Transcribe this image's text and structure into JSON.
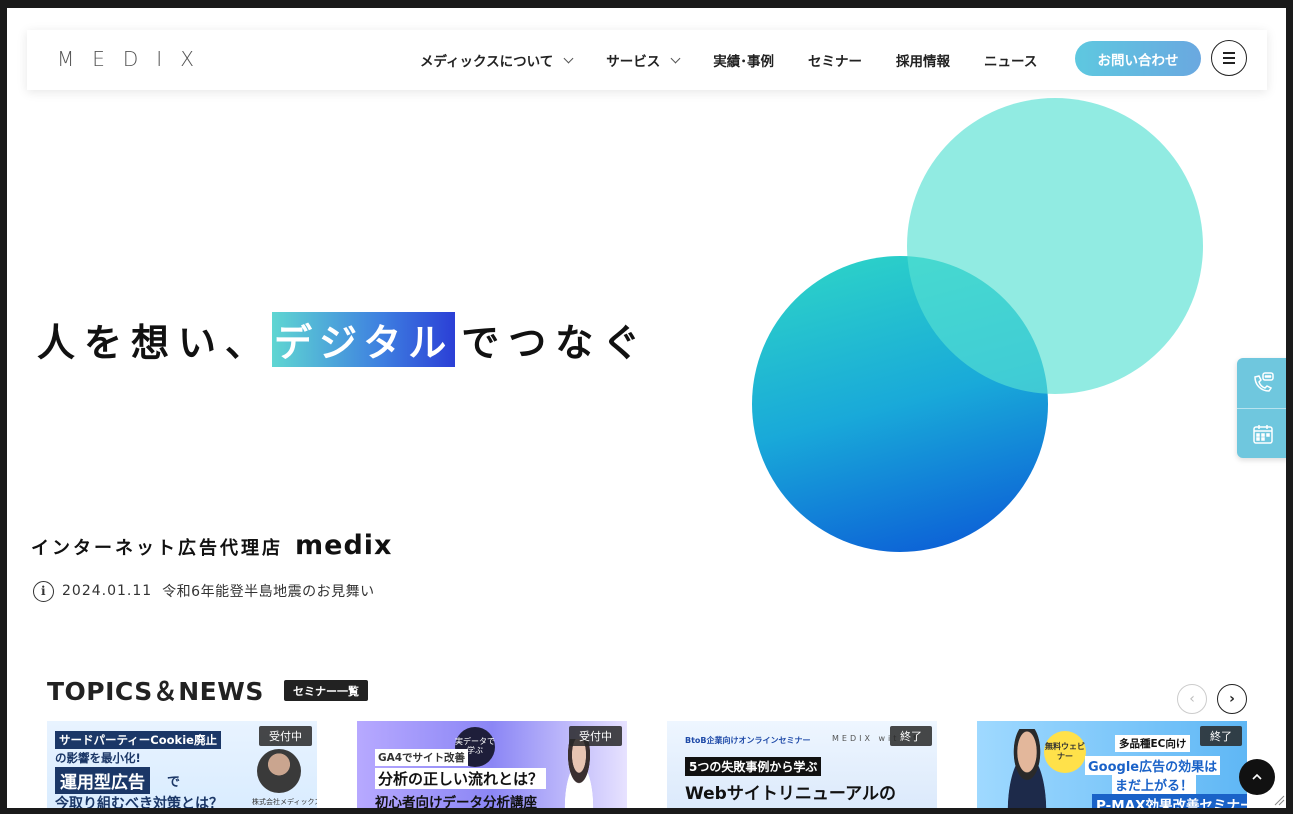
{
  "header": {
    "logo": "MEDIX",
    "nav": [
      {
        "label": "メディックスについて",
        "has_dropdown": true
      },
      {
        "label": "サービス",
        "has_dropdown": true
      },
      {
        "label": "実績･事例",
        "has_dropdown": false
      },
      {
        "label": "セミナー",
        "has_dropdown": false
      },
      {
        "label": "採用情報",
        "has_dropdown": false
      },
      {
        "label": "ニュース",
        "has_dropdown": false
      }
    ],
    "contact_label": "お問い合わせ"
  },
  "hero": {
    "tagline_pre": "人を想い、",
    "tagline_highlight": "デジタル",
    "tagline_post": "でつなぐ",
    "subtitle": "インターネット広告代理店",
    "brand": "medix",
    "notice_date": "2024.01.11",
    "notice_text": "令和6年能登半島地震のお見舞い"
  },
  "topics": {
    "title": "TOPICS＆NEWS",
    "seminar_list_label": "セミナー一覧",
    "cards": [
      {
        "status": "受付中",
        "lines": [
          "サードパーティーCookie廃止",
          "の影響を最小化!",
          "運用型広告",
          "で",
          "今取り組むべき対策とは？"
        ],
        "org": "株式会社メディックス"
      },
      {
        "status": "受付中",
        "badge": "実データで学ぶ",
        "lines": [
          "GA4でサイト改善",
          "分析の正しい流れとは？",
          "初心者向けデータ分析講座"
        ]
      },
      {
        "status": "終了",
        "lines": [
          "BtoB企業向けオンラインセミナー",
          "MEDIX with f",
          "5つの失敗事例から学ぶ",
          "Webサイトリニューアルの"
        ]
      },
      {
        "status": "終了",
        "badge": "無料ウェビナー",
        "lines": [
          "多品種EC向け",
          "Google広告の効果は",
          "まだ上がる！",
          "P-MAX効果改善セミナー"
        ]
      }
    ]
  },
  "colors": {
    "accent_teal": "#56e0d2",
    "accent_blue": "#0a55d6",
    "contact_button": "#5ec8e0",
    "side_tab": "#6fc7de"
  },
  "icons": {
    "side_tab_1": "phone-chat-icon",
    "side_tab_2": "calendar-icon",
    "notice": "info-icon",
    "to_top": "chevron-up-icon"
  }
}
